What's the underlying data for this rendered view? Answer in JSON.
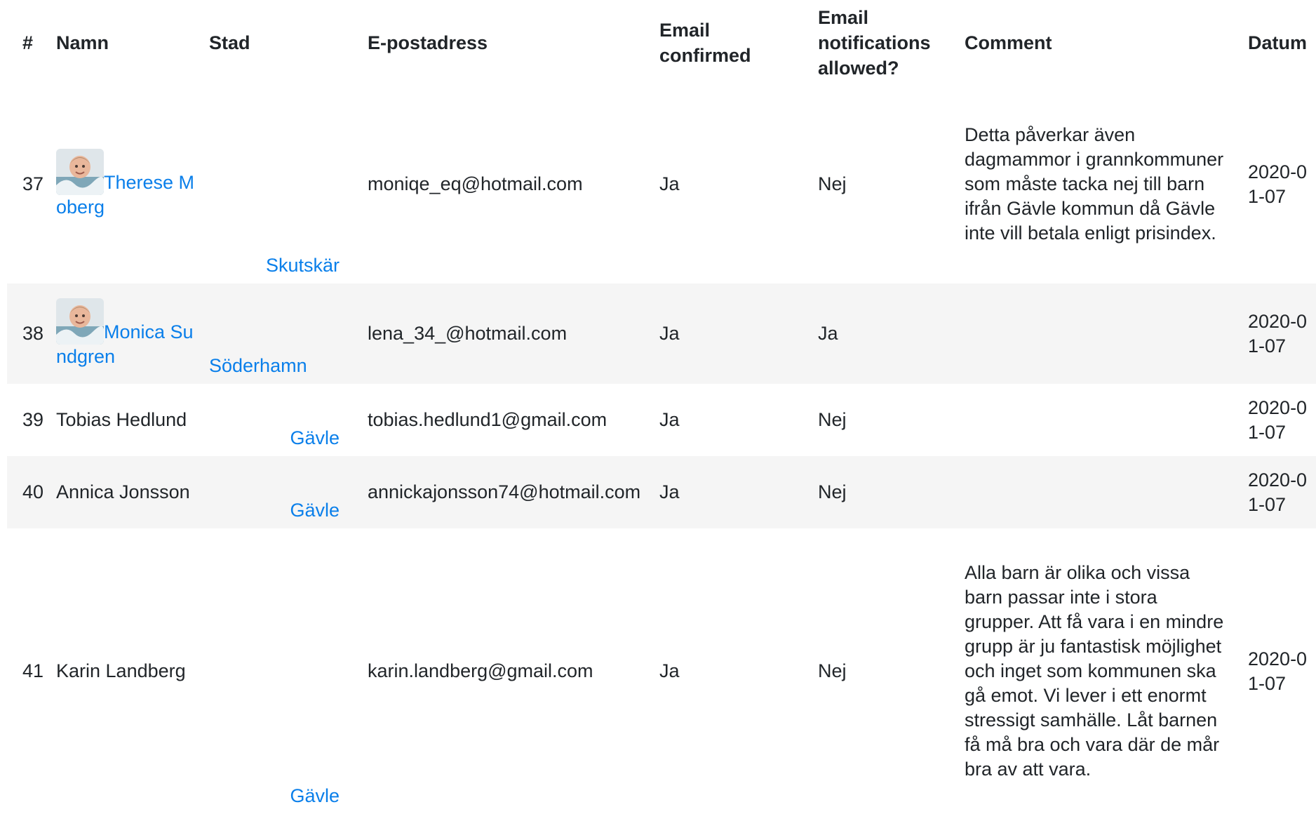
{
  "table": {
    "headers": {
      "num": "#",
      "name": "Namn",
      "city": "Stad",
      "email": "E-postadress",
      "confirmed": "Email confirmed",
      "notifications": "Email notifications allowed?",
      "comment": "Comment",
      "date": "Datum"
    },
    "rows": [
      {
        "num": "37",
        "name": "Therese Moberg",
        "city": "Skutskär",
        "email": "moniqe_eq@hotmail.com",
        "confirmed": "Ja",
        "notifications": "Nej",
        "comment": "Detta påverkar även dagmammor i grannkommuner som måste tacka nej till barn ifrån Gävle kommun då Gävle inte vill betala enligt prisindex.",
        "date": "2020-01-07"
      },
      {
        "num": "38",
        "name": "Monica Sundgren",
        "city": "Söderhamn",
        "email": "lena_34_@hotmail.com",
        "confirmed": "Ja",
        "notifications": "Ja",
        "comment": "",
        "date": "2020-01-07"
      },
      {
        "num": "39",
        "name": "Tobias Hedlund",
        "city": "Gävle",
        "email": "tobias.hedlund1@gmail.com",
        "confirmed": "Ja",
        "notifications": "Nej",
        "comment": "",
        "date": "2020-01-07"
      },
      {
        "num": "40",
        "name": "Annica Jonsson",
        "city": "Gävle",
        "email": "annickajonsson74@hotmail.com",
        "confirmed": "Ja",
        "notifications": "Nej",
        "comment": "",
        "date": "2020-01-07"
      },
      {
        "num": "41",
        "name": "Karin Landberg",
        "city": "Gävle",
        "email": "karin.landberg@gmail.com",
        "confirmed": "Ja",
        "notifications": "Nej",
        "comment": "Alla barn är olika och vissa barn passar inte i stora grupper. Att få vara i en mindre grupp är ju fantastisk möjlighet och inget som kommunen ska gå emot. Vi lever i ett enormt stressigt samhälle. Låt barnen få må bra och vara där de mår bra av att vara.",
        "date": "2020-01-07"
      }
    ]
  },
  "colors": {
    "link": "#0a7fea",
    "row_shade": "#f5f5f5",
    "text": "#212529"
  },
  "icons": {
    "avatar": "baby-photo-avatar-icon"
  }
}
